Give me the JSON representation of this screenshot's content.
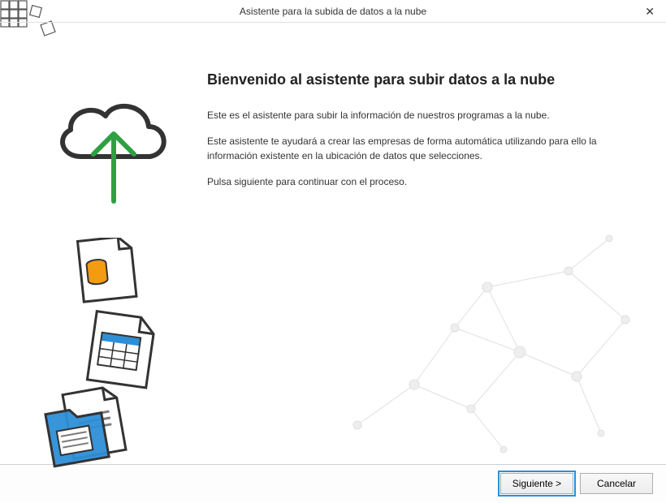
{
  "window": {
    "title": "Asistente para la subida de datos a la nube"
  },
  "main": {
    "heading": "Bienvenido al asistente para subir datos a la nube",
    "para1": "Este es el asistente para subir la información de nuestros programas a la nube.",
    "para2": "Este asistente te ayudará a crear las empresas de forma automática utilizando para ello la información existente en la ubicación de datos que selecciones.",
    "para3": "Pulsa siguiente para continuar con el proceso."
  },
  "footer": {
    "next_label": "Siguiente >",
    "cancel_label": "Cancelar"
  },
  "icons": {
    "cloud_upload": "cloud-upload-icon",
    "documents": "documents-stack-icon",
    "close": "close-icon"
  }
}
